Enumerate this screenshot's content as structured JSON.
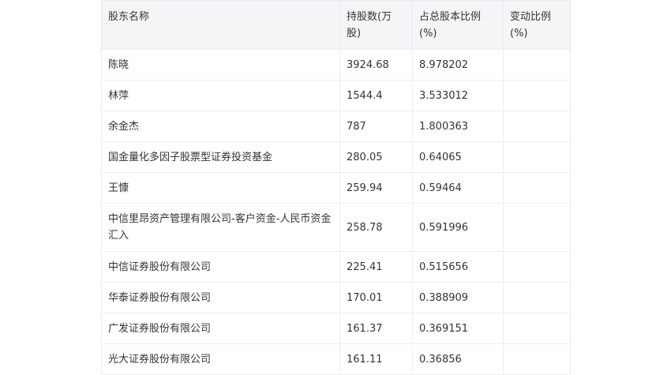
{
  "table": {
    "headers": [
      "股东名称",
      "持股数(万股)",
      "占总股本比例(%)",
      "变动比例(%)"
    ],
    "rows": [
      {
        "name": "陈晓",
        "shares": "3924.68",
        "ratio": "8.978202",
        "change": ""
      },
      {
        "name": "林萍",
        "shares": "1544.4",
        "ratio": "3.533012",
        "change": ""
      },
      {
        "name": "余金杰",
        "shares": "787",
        "ratio": "1.800363",
        "change": ""
      },
      {
        "name": "国金量化多因子股票型证券投资基金",
        "shares": "280.05",
        "ratio": "0.64065",
        "change": ""
      },
      {
        "name": "王慷",
        "shares": "259.94",
        "ratio": "0.59464",
        "change": ""
      },
      {
        "name": "中信里昂资产管理有限公司-客户资金-人民币资金汇入",
        "shares": "258.78",
        "ratio": "0.591996",
        "change": ""
      },
      {
        "name": "中信证券股份有限公司",
        "shares": "225.41",
        "ratio": "0.515656",
        "change": ""
      },
      {
        "name": "华泰证券股份有限公司",
        "shares": "170.01",
        "ratio": "0.388909",
        "change": ""
      },
      {
        "name": "广发证券股份有限公司",
        "shares": "161.37",
        "ratio": "0.369151",
        "change": ""
      },
      {
        "name": "光大证券股份有限公司",
        "shares": "161.11",
        "ratio": "0.36856",
        "change": ""
      }
    ]
  }
}
